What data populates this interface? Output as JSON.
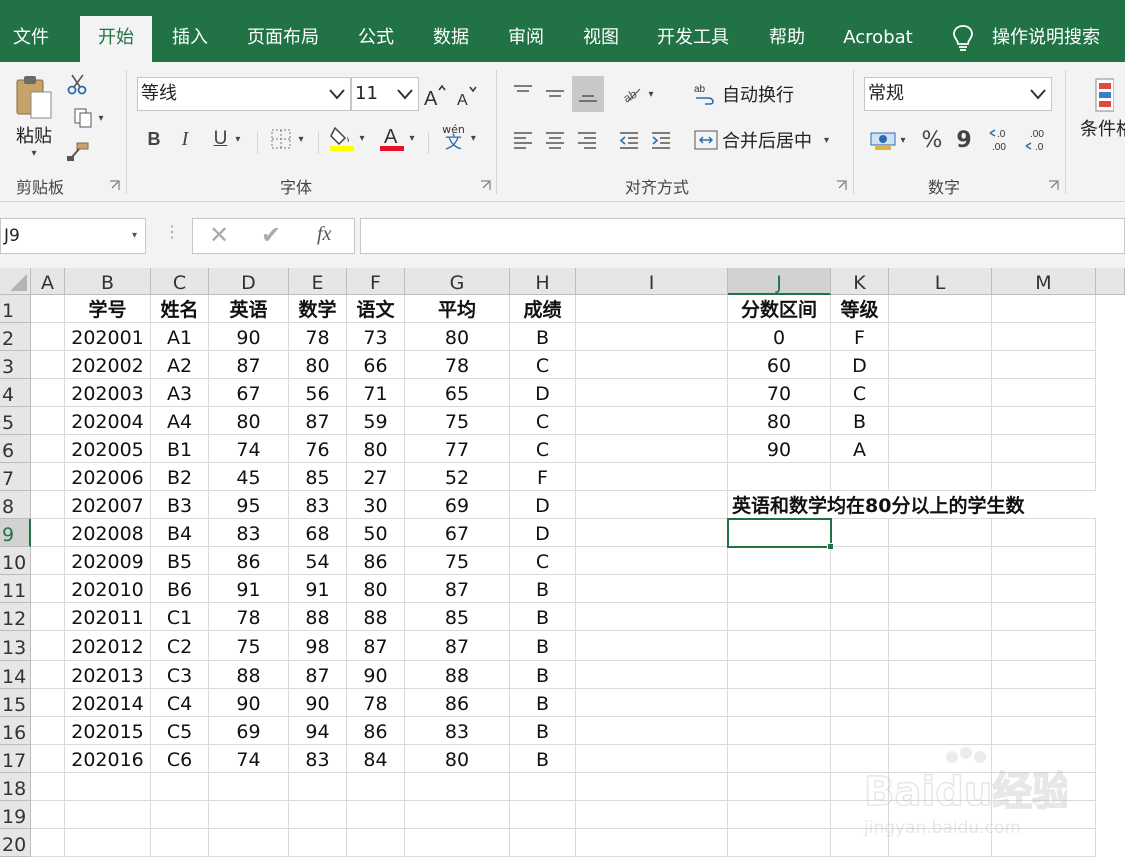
{
  "tabs": [
    {
      "label": "文件",
      "name": "tab-file"
    },
    {
      "label": "开始",
      "name": "tab-home"
    },
    {
      "label": "插入",
      "name": "tab-insert"
    },
    {
      "label": "页面布局",
      "name": "tab-page-layout"
    },
    {
      "label": "公式",
      "name": "tab-formulas"
    },
    {
      "label": "数据",
      "name": "tab-data"
    },
    {
      "label": "审阅",
      "name": "tab-review"
    },
    {
      "label": "视图",
      "name": "tab-view"
    },
    {
      "label": "开发工具",
      "name": "tab-developer"
    },
    {
      "label": "帮助",
      "name": "tab-help"
    },
    {
      "label": "Acrobat",
      "name": "tab-acrobat"
    },
    {
      "label": "操作说明搜索",
      "name": "tab-tell-me"
    }
  ],
  "ribbon": {
    "clipboard": {
      "paste": "粘贴",
      "label": "剪贴板"
    },
    "font": {
      "name": "等线",
      "size": "11",
      "label": "字体",
      "bold": "B",
      "italic": "I",
      "underline": "U",
      "phonetic_top": "wén",
      "phonetic_bottom": "文"
    },
    "alignment": {
      "wrap": "自动换行",
      "merge": "合并后居中",
      "label": "对齐方式"
    },
    "number": {
      "format": "常规",
      "percent": "%",
      "comma": "9",
      "label": "数字"
    },
    "styles": {
      "conditional": "条件格"
    }
  },
  "formula_bar": {
    "name_box": "J9",
    "fx": "fx",
    "content": ""
  },
  "columns": [
    "A",
    "B",
    "C",
    "D",
    "E",
    "F",
    "G",
    "H",
    "I",
    "J",
    "K",
    "L",
    "M"
  ],
  "rows": [
    "1",
    "2",
    "3",
    "4",
    "5",
    "6",
    "7",
    "8",
    "9",
    "10",
    "11",
    "12",
    "13",
    "14",
    "15",
    "16",
    "17",
    "18",
    "19",
    "20"
  ],
  "selected_cell": "J9",
  "table": {
    "headers": [
      "学号",
      "姓名",
      "英语",
      "数学",
      "语文",
      "平均",
      "成绩"
    ],
    "rows": [
      [
        "202001",
        "A1",
        "90",
        "78",
        "73",
        "80",
        "B"
      ],
      [
        "202002",
        "A2",
        "87",
        "80",
        "66",
        "78",
        "C"
      ],
      [
        "202003",
        "A3",
        "67",
        "56",
        "71",
        "65",
        "D"
      ],
      [
        "202004",
        "A4",
        "80",
        "87",
        "59",
        "75",
        "C"
      ],
      [
        "202005",
        "B1",
        "74",
        "76",
        "80",
        "77",
        "C"
      ],
      [
        "202006",
        "B2",
        "45",
        "85",
        "27",
        "52",
        "F"
      ],
      [
        "202007",
        "B3",
        "95",
        "83",
        "30",
        "69",
        "D"
      ],
      [
        "202008",
        "B4",
        "83",
        "68",
        "50",
        "67",
        "D"
      ],
      [
        "202009",
        "B5",
        "86",
        "54",
        "86",
        "75",
        "C"
      ],
      [
        "202010",
        "B6",
        "91",
        "91",
        "80",
        "87",
        "B"
      ],
      [
        "202011",
        "C1",
        "78",
        "88",
        "88",
        "85",
        "B"
      ],
      [
        "202012",
        "C2",
        "75",
        "98",
        "87",
        "87",
        "B"
      ],
      [
        "202013",
        "C3",
        "88",
        "87",
        "90",
        "88",
        "B"
      ],
      [
        "202014",
        "C4",
        "90",
        "90",
        "78",
        "86",
        "B"
      ],
      [
        "202015",
        "C5",
        "69",
        "94",
        "86",
        "83",
        "B"
      ],
      [
        "202016",
        "C6",
        "74",
        "83",
        "84",
        "80",
        "B"
      ]
    ]
  },
  "grade_table": {
    "headers": [
      "分数区间",
      "等级"
    ],
    "rows": [
      [
        "0",
        "F"
      ],
      [
        "60",
        "D"
      ],
      [
        "70",
        "C"
      ],
      [
        "80",
        "B"
      ],
      [
        "90",
        "A"
      ]
    ]
  },
  "question": "英语和数学均在80分以上的学生数",
  "watermark": {
    "brand": "Baidu经验",
    "url": "jingyan.baidu.com"
  }
}
